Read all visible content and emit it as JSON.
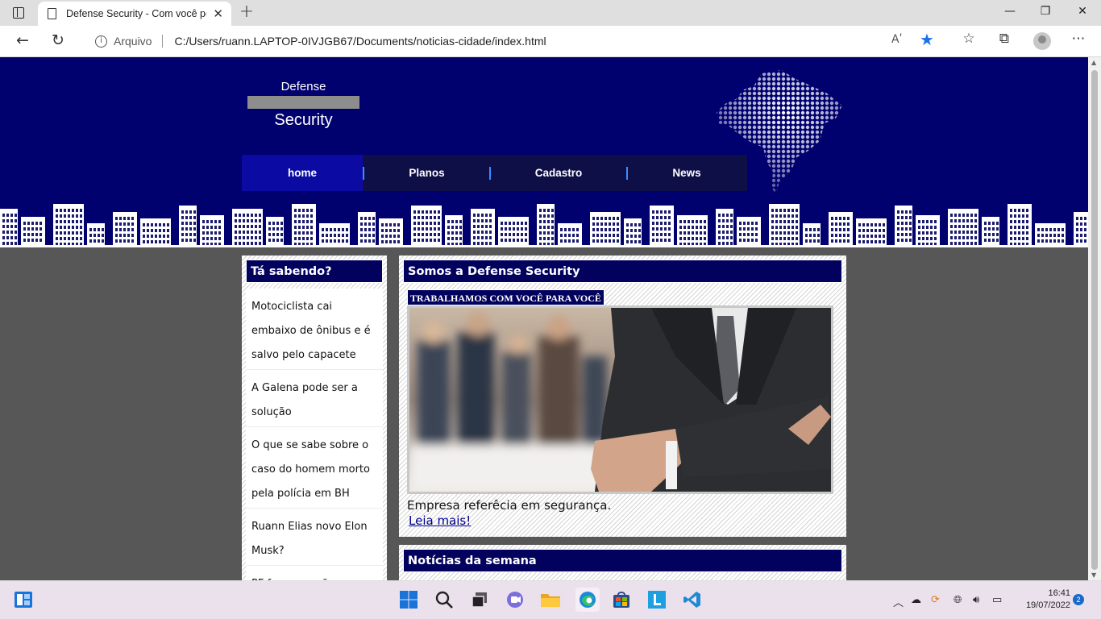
{
  "browser": {
    "tab_title": "Defense Security - Com você por",
    "address_prefix": "Arquivo",
    "url": "C:/Users/ruann.LAPTOP-0IVJGB67/Documents/noticias-cidade/index.html",
    "read_aloud": "Aʹ"
  },
  "site": {
    "logo_top": "Defense",
    "logo_bottom": "Security",
    "menu": [
      {
        "label": "home",
        "active": true
      },
      {
        "label": "Planos",
        "active": false
      },
      {
        "label": "Cadastro",
        "active": false
      },
      {
        "label": "News",
        "active": false
      }
    ],
    "sidebar": {
      "title": "Tá sabendo?",
      "items": [
        "Motociclista cai embaixo de ônibus e é salvo pelo capacete",
        "A Galena pode ser a solução",
        "O que se sabe sobre o caso do homem morto pela polícia em BH",
        "Ruann Elias novo Elon Musk?",
        "PF faz operação para"
      ]
    },
    "about": {
      "title": "Somos a Defense Security",
      "tagline": "TRABALHAMOS COM VOCÊ PARA VOCÊ",
      "description": "Empresa referêcia em segurança.",
      "read_more": "Leia mais!"
    },
    "news": {
      "title": "Notícias da semana"
    }
  },
  "taskbar": {
    "time": "16:41",
    "date": "19/07/2022",
    "notifications": "2"
  },
  "colors": {
    "header_bg": "#00006e",
    "menu_bg": "#0f0f47",
    "menu_active": "#0b0ba3",
    "box_title_bg": "#02025e",
    "page_bg": "#575757"
  }
}
